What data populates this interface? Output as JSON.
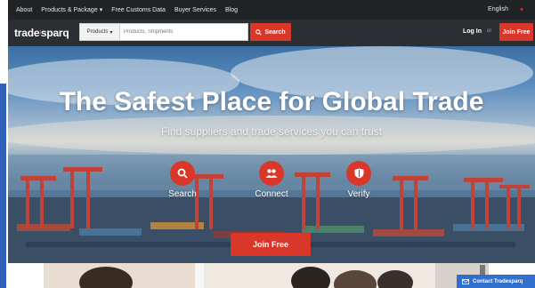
{
  "topbar": {
    "nav": [
      {
        "label": "About",
        "dropdown": false
      },
      {
        "label": "Products & Package",
        "dropdown": true
      },
      {
        "label": "Free Customs Data",
        "dropdown": false
      },
      {
        "label": "Buyer Services",
        "dropdown": false
      },
      {
        "label": "Blog",
        "dropdown": false
      }
    ],
    "language": "English",
    "flag_icon": "china-flag-icon"
  },
  "header": {
    "logo_left": "trade",
    "logo_right": "sparq",
    "search": {
      "category": "Products",
      "placeholder": "Products, Shipments",
      "button_label": "Search"
    },
    "login_label": "Log In",
    "or_label": "or",
    "join_label": "Join Free"
  },
  "hero": {
    "title": "The Safest Place for Global Trade",
    "subtitle": "Find suppliers and trade services you can trust",
    "features": [
      {
        "label": "Search",
        "icon": "search-icon"
      },
      {
        "label": "Connect",
        "icon": "people-icon"
      },
      {
        "label": "Verify",
        "icon": "shield-icon"
      }
    ],
    "join_label": "Join Free"
  },
  "contact": {
    "label": "Contact Tradesparq",
    "icon": "mail-icon"
  },
  "colors": {
    "accent": "#d9372a",
    "topbar": "#1f2326",
    "header": "#2b2f33",
    "contact": "#2f6fd0"
  }
}
